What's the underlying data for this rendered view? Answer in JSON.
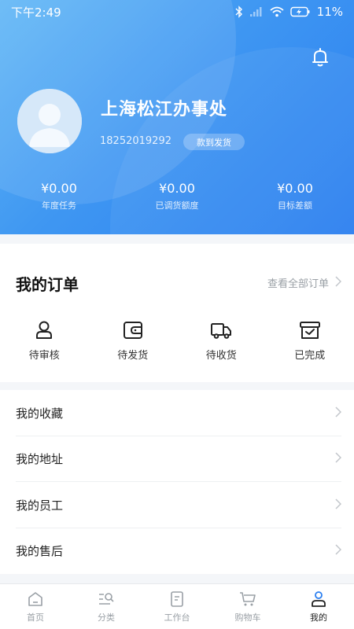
{
  "status_bar": {
    "time": "下午2:49",
    "battery": "11%"
  },
  "profile": {
    "org_name": "上海松江办事处",
    "phone": "18252019292",
    "tag": "款到发货"
  },
  "stats": [
    {
      "value": "¥0.00",
      "label": "年度任务"
    },
    {
      "value": "¥0.00",
      "label": "已调货额度"
    },
    {
      "value": "¥0.00",
      "label": "目标差额"
    }
  ],
  "orders": {
    "title": "我的订单",
    "view_all": "查看全部订单",
    "items": [
      {
        "label": "待审核",
        "icon": "user-check-icon"
      },
      {
        "label": "待发货",
        "icon": "wallet-icon"
      },
      {
        "label": "待收货",
        "icon": "truck-icon"
      },
      {
        "label": "已完成",
        "icon": "archive-check-icon"
      }
    ]
  },
  "menu": [
    {
      "label": "我的收藏"
    },
    {
      "label": "我的地址"
    },
    {
      "label": "我的员工"
    },
    {
      "label": "我的售后"
    }
  ],
  "tabbar": [
    {
      "label": "首页",
      "icon": "home-icon"
    },
    {
      "label": "分类",
      "icon": "category-search-icon"
    },
    {
      "label": "工作台",
      "icon": "workbench-icon"
    },
    {
      "label": "购物车",
      "icon": "cart-icon"
    },
    {
      "label": "我的",
      "icon": "profile-icon"
    }
  ],
  "colors": {
    "brand_blue": "#2a7ef0",
    "text_primary": "#222222",
    "text_muted": "#9aa0a6"
  }
}
